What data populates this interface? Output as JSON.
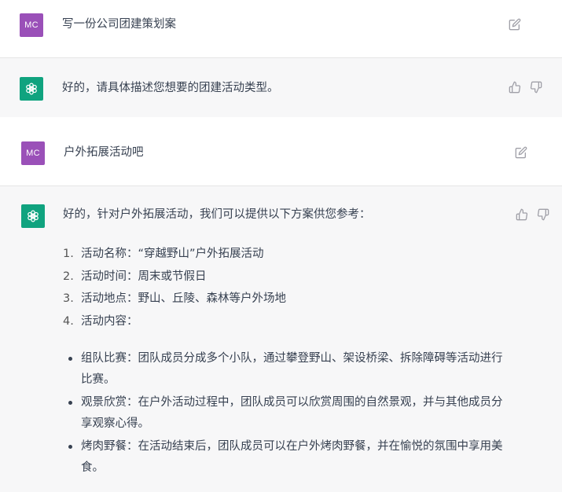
{
  "messages": [
    {
      "role": "user",
      "avatar": "MC",
      "text": "写一份公司团建策划案"
    },
    {
      "role": "assistant",
      "text": "好的，请具体描述您想要的团建活动类型。"
    },
    {
      "role": "user",
      "avatar": "MC",
      "text": "户外拓展活动吧"
    },
    {
      "role": "assistant",
      "intro": "好的，针对户外拓展活动，我们可以提供以下方案供您参考：",
      "steps": [
        {
          "num": "1.",
          "text": "活动名称：“穿越野山”户外拓展活动"
        },
        {
          "num": "2.",
          "text": "活动时间：周末或节假日"
        },
        {
          "num": "3.",
          "text": "活动地点：野山、丘陵、森林等户外场地"
        },
        {
          "num": "4.",
          "text": "活动内容："
        }
      ],
      "bullets": [
        "组队比赛：团队成员分成多个小队，通过攀登野山、架设桥梁、拆除障碍等活动进行比赛。",
        "观景欣赏：在户外活动过程中，团队成员可以欣赏周围的自然景观，并与其他成员分享观察心得。",
        "烤肉野餐：在活动结束后，团队成员可以在户外烤肉野餐，并在愉悦的氛围中享用美食。"
      ]
    }
  ],
  "icons": {
    "edit": "edit-icon",
    "thumbs_up": "thumbs-up-icon",
    "thumbs_down": "thumbs-down-icon",
    "assistant_logo": "openai-logo-icon"
  },
  "colors": {
    "user_avatar": "#9a50b8",
    "assistant_avatar": "#10a37f",
    "assistant_bg": "#f7f7f8",
    "icon_gray": "#a0a0a8"
  }
}
